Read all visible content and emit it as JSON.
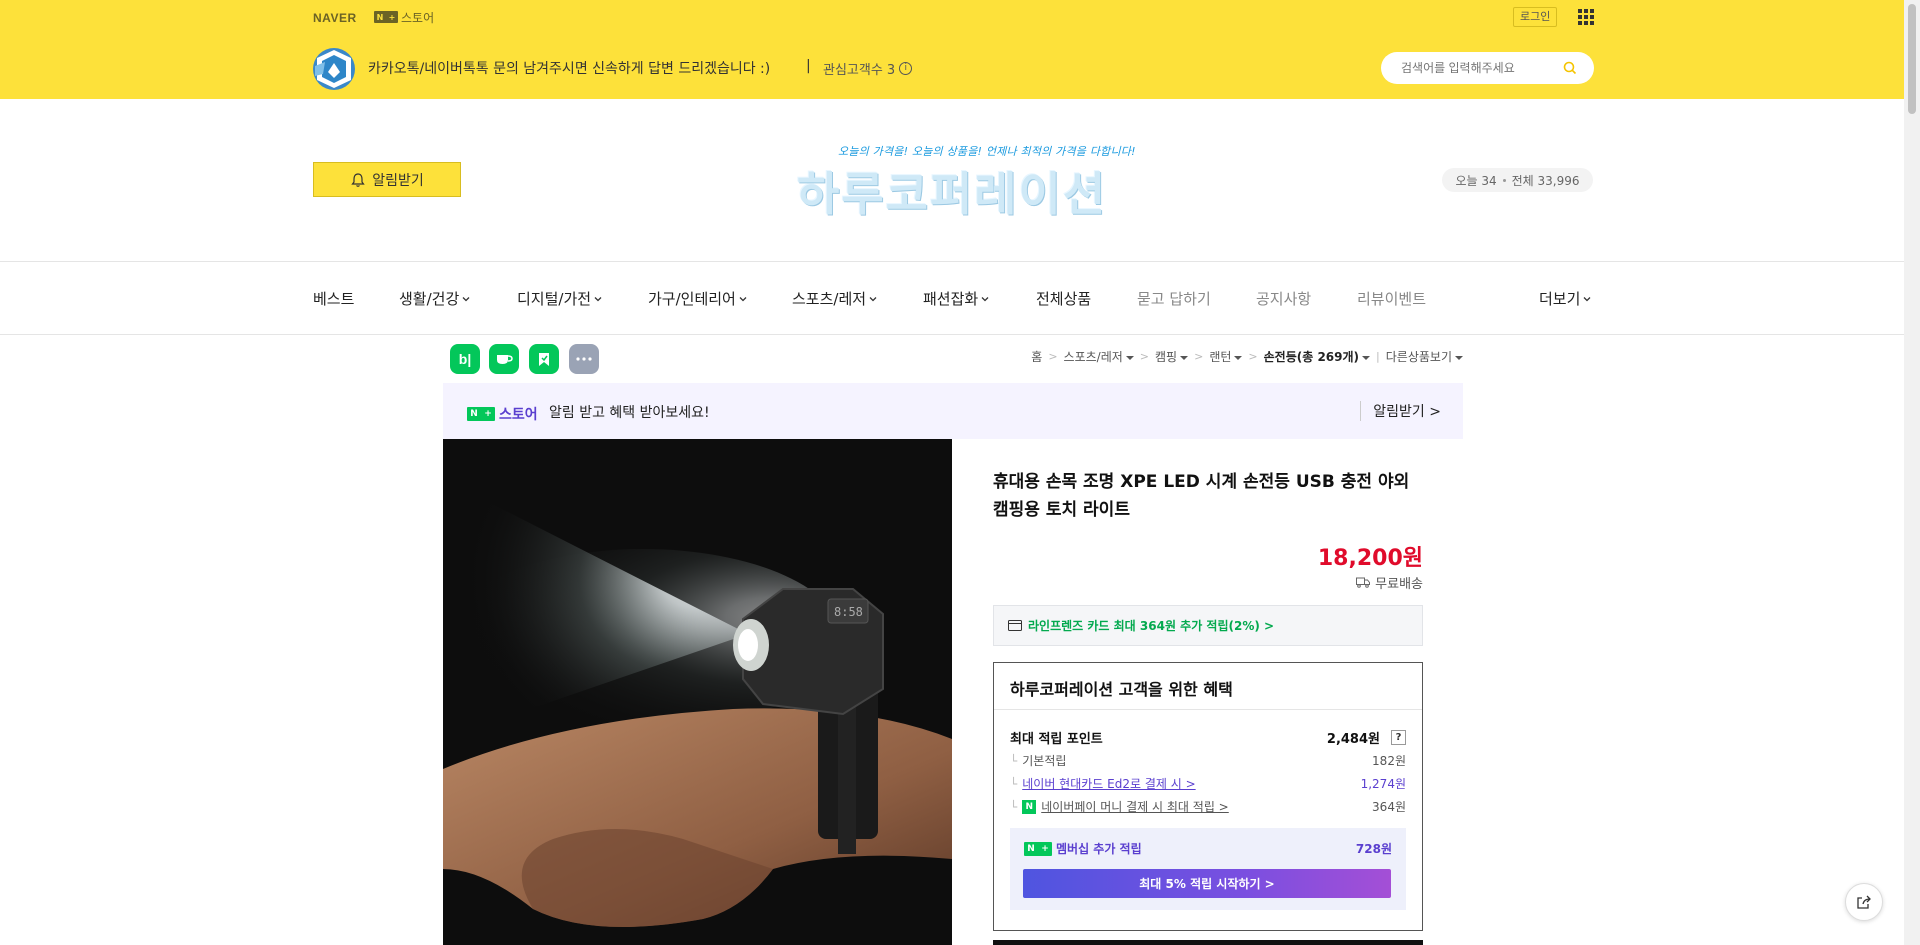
{
  "top_bar": {
    "naver_label": "NAVER",
    "nplus_store": "스토어",
    "login": "로그인",
    "apps_icon": "grid-icon"
  },
  "store_bar": {
    "message": "카카오톡/네이버톡톡 문의 남겨주시면 신속하게 답변 드리겠습니다 :)",
    "separator": "|",
    "favorite_label": "관심고객수 3",
    "search_placeholder": "검색어를 입력해주세요"
  },
  "header": {
    "alarm_button": "알림받기",
    "logo_tagline": "오늘의 가격을! 오늘의 상품을! 언제나 최적의 가격을 다합니다!",
    "logo_name": "하루코퍼레이션",
    "visitors_today": "오늘 34",
    "visitors_total": "전체 33,996"
  },
  "nav": [
    {
      "label": "베스트",
      "dropdown": false,
      "muted": false
    },
    {
      "label": "생활/건강",
      "dropdown": true,
      "muted": false
    },
    {
      "label": "디지털/가전",
      "dropdown": true,
      "muted": false
    },
    {
      "label": "가구/인테리어",
      "dropdown": true,
      "muted": false
    },
    {
      "label": "스포츠/레저",
      "dropdown": true,
      "muted": false
    },
    {
      "label": "패션잡화",
      "dropdown": true,
      "muted": false
    },
    {
      "label": "전체상품",
      "dropdown": false,
      "muted": false
    },
    {
      "label": "묻고 답하기",
      "dropdown": false,
      "muted": true
    },
    {
      "label": "공지사항",
      "dropdown": false,
      "muted": true
    },
    {
      "label": "리뷰이벤트",
      "dropdown": false,
      "muted": true
    },
    {
      "label": "더보기",
      "dropdown": true,
      "muted": false
    }
  ],
  "share_icons": [
    "blog-icon",
    "cafe-icon",
    "bookmark-icon",
    "more-icon"
  ],
  "breadcrumb": {
    "home": "홈",
    "level1": "스포츠/레저",
    "level2": "캠핑",
    "level3": "랜턴",
    "current": "손전등(총 269개)",
    "other": "다른상품보기"
  },
  "notice": {
    "store_label": "스토어",
    "text": "알림 받고 혜택 받아보세요!",
    "alarm": "알림받기 >"
  },
  "product": {
    "title": "휴대용 손목 조명 XPE LED 시계 손전등 USB 충전 야외 캠핑용 토치 라이트",
    "price": "18,200원",
    "shipping": "무료배송",
    "card_benefit": "라인프렌즈 카드 최대 364원 추가 적립(2%) >"
  },
  "benefits": {
    "title": "하루코퍼레이션 고객을 위한 혜택",
    "max_points_label": "최대 적립 포인트",
    "max_points_value": "2,484원",
    "help": "?",
    "rows": [
      {
        "label": "기본적립",
        "value": "182원"
      },
      {
        "label": "네이버 현대카드 Ed2로 결제 시 >",
        "value": "1,274원"
      },
      {
        "label": "네이버페이 머니 결제 시 최대 적립 >",
        "value": "364원"
      }
    ],
    "member_label": "멤버십 추가 적립",
    "member_value": "728원",
    "member_button": "최대 5% 적립 시작하기 >"
  },
  "colors": {
    "brand_yellow": "#fde13a",
    "price_red": "#e00b2b",
    "naver_green": "#03c75a",
    "membership_purple": "#5a3fcf"
  }
}
